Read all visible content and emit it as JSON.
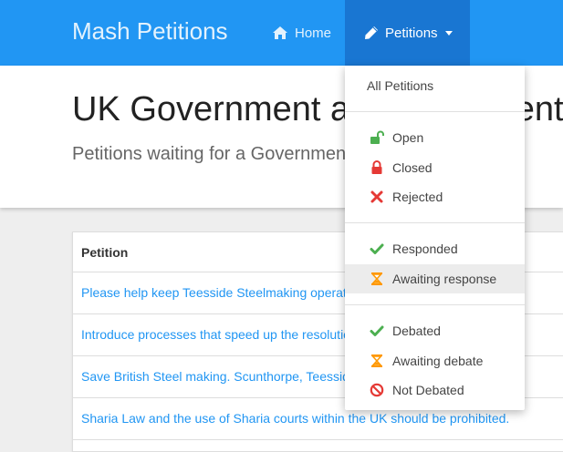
{
  "navbar": {
    "brand": "Mash Petitions",
    "home_label": "Home",
    "petitions_label": "Petitions",
    "accent_color": "#2196f3",
    "active_color": "#1976d2"
  },
  "hero": {
    "title": "UK Government and Parliament",
    "subtitle": "Petitions waiting for a Government response"
  },
  "table": {
    "header": "Petition",
    "rows": [
      "Please help keep Teesside Steelmaking operational",
      "Introduce processes that speed up the resolution of Sharia Law",
      "Save British Steel making. Scunthorpe, Teesside",
      "Sharia Law and the use of Sharia courts within the UK should be prohibited."
    ]
  },
  "dropdown": {
    "all_label": "All Petitions",
    "items": [
      {
        "label": "Open",
        "icon": "unlock-icon",
        "color": "#4caf50"
      },
      {
        "label": "Closed",
        "icon": "lock-icon",
        "color": "#e53935"
      },
      {
        "label": "Rejected",
        "icon": "cross-icon",
        "color": "#e53935"
      },
      {
        "label": "Responded",
        "icon": "check-icon",
        "color": "#4caf50"
      },
      {
        "label": "Awaiting response",
        "icon": "hourglass-icon",
        "color": "#ff9800"
      },
      {
        "label": "Debated",
        "icon": "check-icon",
        "color": "#4caf50"
      },
      {
        "label": "Awaiting debate",
        "icon": "hourglass-icon",
        "color": "#ff9800"
      },
      {
        "label": "Not Debated",
        "icon": "ban-icon",
        "color": "#e53935"
      }
    ]
  }
}
